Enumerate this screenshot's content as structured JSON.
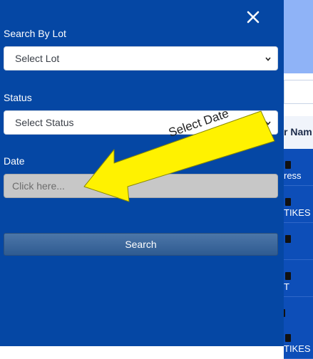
{
  "panel": {
    "lot_label": "Search By Lot",
    "lot_select_value": "Select Lot",
    "status_label": "Status",
    "status_select_value": "Select Status",
    "date_label": "Date",
    "date_placeholder": "Click here...",
    "search_button": "Search",
    "close_icon": "close-icon"
  },
  "background": {
    "column_header": "r Nam",
    "rows": [
      "ress",
      "TIKES",
      "",
      "T",
      "",
      "TIKES"
    ]
  },
  "annotation": {
    "callout_text": "Select Date",
    "arrow_color": "#fff200"
  },
  "colors": {
    "panel_bg": "#0547a4",
    "button_bg": "#3d6aa0",
    "date_input_bg": "#c7c7c7"
  }
}
